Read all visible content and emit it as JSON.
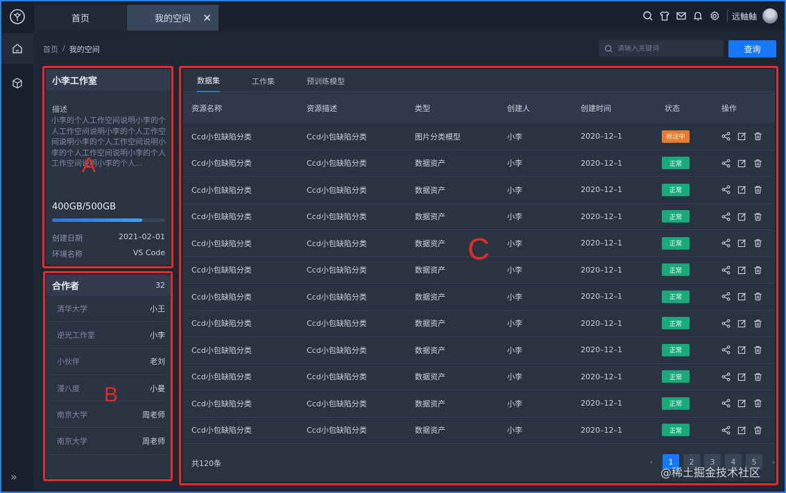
{
  "top": {
    "tabs": [
      {
        "label": "首页"
      },
      {
        "label": "我的空间",
        "close": "✕"
      }
    ],
    "username": "远鲉鲉"
  },
  "breadcrumb": {
    "home": "首页",
    "sep": "/",
    "current": "我的空间"
  },
  "search": {
    "placeholder": "请输入关键词",
    "button": "查询"
  },
  "workspace": {
    "title": "小李工作室",
    "desc_label": "描述",
    "desc": "小李的个人工作空间说明小李的个人工作空间说明小李的个人工作空间说明小李的个人工作空间说明小李的个人工作空间说明小李的个人工作空间说明小李的个人...",
    "storage_text": "400GB/500GB",
    "storage_fraction": 0.8,
    "created_label": "创建日期",
    "created_value": "2021–02–01",
    "env_label": "环境名称",
    "env_value": "VS Code"
  },
  "collaborators": {
    "title": "合作者",
    "count": "32",
    "items": [
      {
        "org": "清华大学",
        "name": "小王"
      },
      {
        "org": "逆光工作室",
        "name": "小李"
      },
      {
        "org": "小伙伴",
        "name": "老刘"
      },
      {
        "org": "漫八度",
        "name": "小曼"
      },
      {
        "org": "南京大学",
        "name": "周老师"
      },
      {
        "org": "南京大学",
        "name": "周老师"
      }
    ]
  },
  "resources": {
    "tabs": [
      "数据集",
      "工作集",
      "预训练模型"
    ],
    "columns": [
      "资源名称",
      "资源描述",
      "类型",
      "创建人",
      "创建时间",
      "状态",
      "操作"
    ],
    "rows": [
      {
        "name": "Ccd小包缺陷分类",
        "desc": "Ccd小包缺陷分类",
        "type": "图片分类模型",
        "creator": "小李",
        "date": "2020–12–1",
        "status": "标注中"
      },
      {
        "name": "Ccd小包缺陷分类",
        "desc": "Ccd小包缺陷分类",
        "type": "数据资产",
        "creator": "小李",
        "date": "2020–12–1",
        "status": "正常"
      },
      {
        "name": "Ccd小包缺陷分类",
        "desc": "Ccd小包缺陷分类",
        "type": "数据资产",
        "creator": "小李",
        "date": "2020–12–1",
        "status": "正常"
      },
      {
        "name": "Ccd小包缺陷分类",
        "desc": "Ccd小包缺陷分类",
        "type": "数据资产",
        "creator": "小李",
        "date": "2020–12–1",
        "status": "正常"
      },
      {
        "name": "Ccd小包缺陷分类",
        "desc": "Ccd小包缺陷分类",
        "type": "数据资产",
        "creator": "小李",
        "date": "2020–12–1",
        "status": "正常"
      },
      {
        "name": "Ccd小包缺陷分类",
        "desc": "Ccd小包缺陷分类",
        "type": "数据资产",
        "creator": "小李",
        "date": "2020–12–1",
        "status": "正常"
      },
      {
        "name": "Ccd小包缺陷分类",
        "desc": "Ccd小包缺陷分类",
        "type": "数据资产",
        "creator": "小李",
        "date": "2020–12–1",
        "status": "正常"
      },
      {
        "name": "Ccd小包缺陷分类",
        "desc": "Ccd小包缺陷分类",
        "type": "数据资产",
        "creator": "小李",
        "date": "2020–12–1",
        "status": "正常"
      },
      {
        "name": "Ccd小包缺陷分类",
        "desc": "Ccd小包缺陷分类",
        "type": "数据资产",
        "creator": "小李",
        "date": "2020–12–1",
        "status": "正常"
      },
      {
        "name": "Ccd小包缺陷分类",
        "desc": "Ccd小包缺陷分类",
        "type": "数据资产",
        "creator": "小李",
        "date": "2020–12–1",
        "status": "正常"
      },
      {
        "name": "Ccd小包缺陷分类",
        "desc": "Ccd小包缺陷分类",
        "type": "数据资产",
        "creator": "小李",
        "date": "2020–12–1",
        "status": "正常"
      },
      {
        "name": "Ccd小包缺陷分类",
        "desc": "Ccd小包缺陷分类",
        "type": "数据资产",
        "creator": "小李",
        "date": "2020–12–1",
        "status": "正常"
      }
    ],
    "total": "共120条",
    "pages": [
      "1",
      "2",
      "3",
      "4",
      "5"
    ],
    "prev": "‹",
    "next": "›",
    "status_colors": {
      "标注中": "#e87c2a",
      "正常": "#1aa97a"
    }
  },
  "annotations": {
    "a": "A",
    "b": "B",
    "c": "C"
  },
  "watermark": "@稀土掘金技术社区",
  "icons": {
    "rail": [
      "logo-icon",
      "home-icon",
      "cube-icon",
      "expand-icon"
    ],
    "top": [
      "search-icon",
      "shirt-icon",
      "mail-icon",
      "bell-icon",
      "gear-icon"
    ],
    "row_ops": [
      "share-icon",
      "edit-icon",
      "trash-icon"
    ]
  },
  "colors": {
    "accent": "#1677ff",
    "annotation": "#e52a2a"
  }
}
